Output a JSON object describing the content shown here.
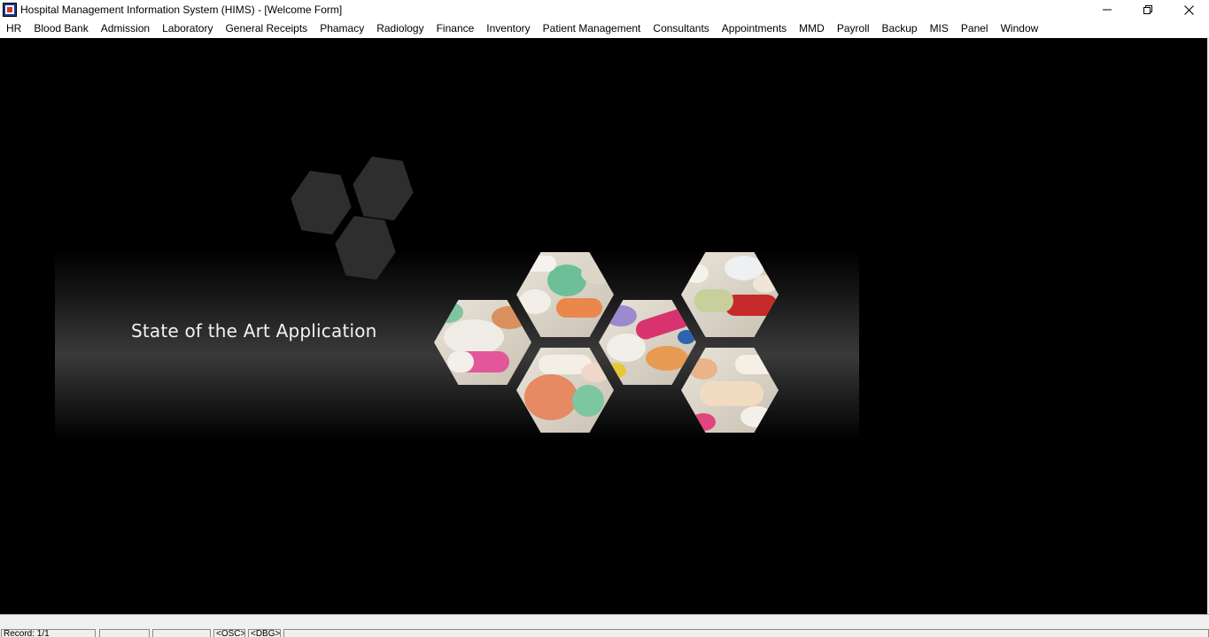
{
  "window": {
    "title": "Hospital Management Information System (HIMS) - [Welcome Form]",
    "icon": "hims-app-icon",
    "controls": [
      "minimize-icon",
      "restore-icon",
      "close-icon"
    ]
  },
  "menu": {
    "items": [
      {
        "label": "HR"
      },
      {
        "label": "Blood Bank"
      },
      {
        "label": "Admission"
      },
      {
        "label": "Laboratory"
      },
      {
        "label": "General Receipts"
      },
      {
        "label": "Phamacy"
      },
      {
        "label": "Radiology"
      },
      {
        "label": "Finance"
      },
      {
        "label": "Inventory"
      },
      {
        "label": "Patient Management"
      },
      {
        "label": "Consultants"
      },
      {
        "label": "Appointments"
      },
      {
        "label": "MMD"
      },
      {
        "label": "Payroll"
      },
      {
        "label": "Backup"
      },
      {
        "label": "MIS"
      },
      {
        "label": "Panel"
      },
      {
        "label": "Window"
      }
    ]
  },
  "welcome": {
    "tagline": "State of the Art Application",
    "pill_image": "pills-hexagon-collage"
  },
  "statusbar": {
    "record": "Record: 1/1",
    "panel2": "",
    "panel3": "",
    "osc": "<OSC>",
    "dbg": "<DBG>"
  },
  "colors": {
    "background": "#000000",
    "deco_hex": "#2e2e2e",
    "tagline": "#f2f2f2"
  }
}
